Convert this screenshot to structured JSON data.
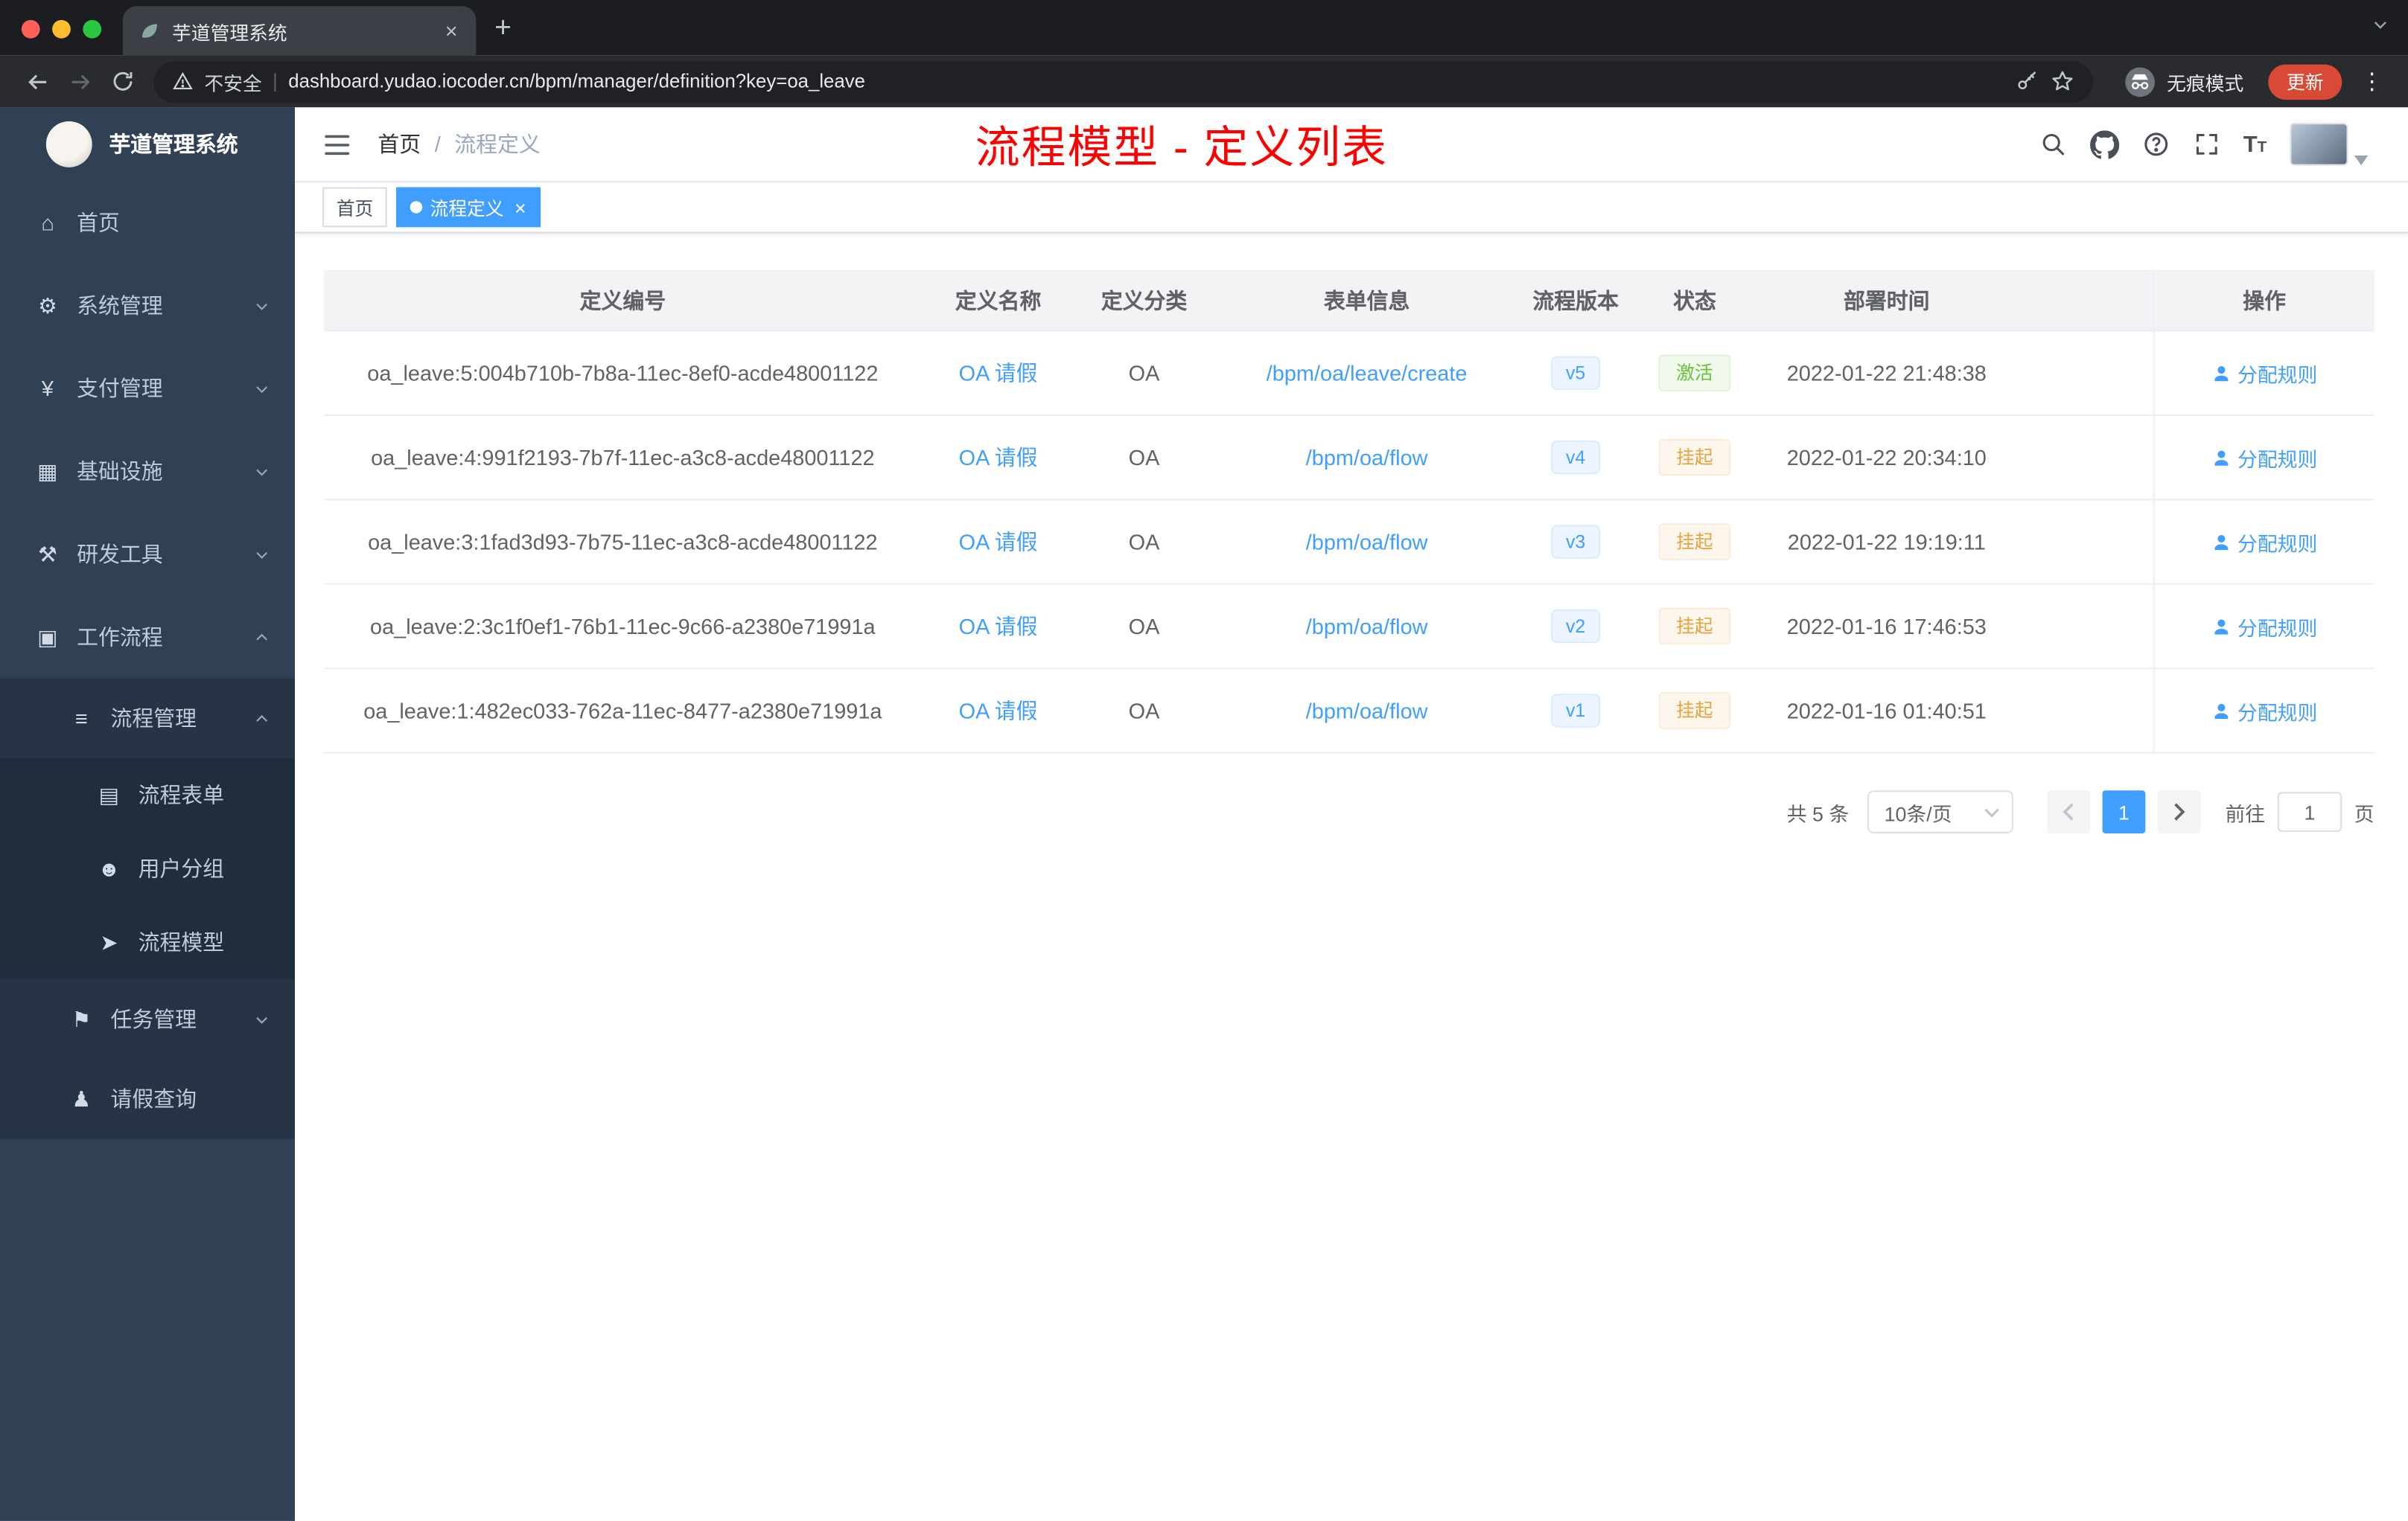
{
  "colors": {
    "accent": "#409eff",
    "success": "#67c23a",
    "warning": "#e6a23c",
    "annotation_red": "#ff0000"
  },
  "browser": {
    "tab": {
      "title": "芋道管理系统"
    },
    "address": {
      "security_label": "不安全",
      "url": "dashboard.yudao.iocoder.cn/bpm/manager/definition?key=oa_leave"
    },
    "incognito_label": "无痕模式",
    "update_label": "更新"
  },
  "sidebar": {
    "logo_title": "芋道管理系统",
    "items": [
      {
        "label": "首页",
        "icon": "home-icon",
        "glyph": "⌂",
        "level": 1,
        "arrow": ""
      },
      {
        "label": "系统管理",
        "icon": "gear-icon",
        "glyph": "⚙",
        "level": 1,
        "arrow": "down"
      },
      {
        "label": "支付管理",
        "icon": "yen-icon",
        "glyph": "¥",
        "level": 1,
        "arrow": "down"
      },
      {
        "label": "基础设施",
        "icon": "infrastructure-icon",
        "glyph": "▦",
        "level": 1,
        "arrow": "down"
      },
      {
        "label": "研发工具",
        "icon": "dev-tools-icon",
        "glyph": "⚒",
        "level": 1,
        "arrow": "down"
      },
      {
        "label": "工作流程",
        "icon": "workflow-icon",
        "glyph": "▣",
        "level": 1,
        "arrow": "up"
      },
      {
        "label": "流程管理",
        "icon": "process-management-icon",
        "glyph": "≡",
        "level": 2,
        "arrow": "up"
      },
      {
        "label": "流程表单",
        "icon": "process-form-icon",
        "glyph": "▤",
        "level": 3,
        "arrow": ""
      },
      {
        "label": "用户分组",
        "icon": "user-group-icon",
        "glyph": "☻",
        "level": 3,
        "arrow": ""
      },
      {
        "label": "流程模型",
        "icon": "process-model-icon",
        "glyph": "➤",
        "level": 3,
        "arrow": ""
      },
      {
        "label": "任务管理",
        "icon": "task-management-icon",
        "glyph": "⚑",
        "level": 2,
        "arrow": "down"
      },
      {
        "label": "请假查询",
        "icon": "leave-query-icon",
        "glyph": "♟",
        "level": 2,
        "arrow": ""
      }
    ]
  },
  "header": {
    "breadcrumb": {
      "home": "首页",
      "separator": "/",
      "current": "流程定义"
    },
    "annotation": "流程模型 - 定义列表"
  },
  "tags": [
    {
      "label": "首页",
      "active": false
    },
    {
      "label": "流程定义",
      "active": true
    }
  ],
  "table": {
    "columns": [
      "定义编号",
      "定义名称",
      "定义分类",
      "表单信息",
      "流程版本",
      "状态",
      "部署时间",
      "操作"
    ],
    "rows": [
      {
        "id": "oa_leave:5:004b710b-7b8a-11ec-8ef0-acde48001122",
        "name": "OA 请假",
        "category": "OA",
        "form": "/bpm/oa/leave/create",
        "version": "v5",
        "status": "激活",
        "status_type": "success",
        "time": "2022-01-22 21:48:38",
        "action": "分配规则"
      },
      {
        "id": "oa_leave:4:991f2193-7b7f-11ec-a3c8-acde48001122",
        "name": "OA 请假",
        "category": "OA",
        "form": "/bpm/oa/flow",
        "version": "v4",
        "status": "挂起",
        "status_type": "warning",
        "time": "2022-01-22 20:34:10",
        "action": "分配规则"
      },
      {
        "id": "oa_leave:3:1fad3d93-7b75-11ec-a3c8-acde48001122",
        "name": "OA 请假",
        "category": "OA",
        "form": "/bpm/oa/flow",
        "version": "v3",
        "status": "挂起",
        "status_type": "warning",
        "time": "2022-01-22 19:19:11",
        "action": "分配规则"
      },
      {
        "id": "oa_leave:2:3c1f0ef1-76b1-11ec-9c66-a2380e71991a",
        "name": "OA 请假",
        "category": "OA",
        "form": "/bpm/oa/flow",
        "version": "v2",
        "status": "挂起",
        "status_type": "warning",
        "time": "2022-01-16 17:46:53",
        "action": "分配规则"
      },
      {
        "id": "oa_leave:1:482ec033-762a-11ec-8477-a2380e71991a",
        "name": "OA 请假",
        "category": "OA",
        "form": "/bpm/oa/flow",
        "version": "v1",
        "status": "挂起",
        "status_type": "warning",
        "time": "2022-01-16 01:40:51",
        "action": "分配规则"
      }
    ]
  },
  "pagination": {
    "total": "共 5 条",
    "page_size": "10条/页",
    "current_page": "1",
    "goto_label": "前往",
    "goto_value": "1",
    "unit_label": "页"
  }
}
